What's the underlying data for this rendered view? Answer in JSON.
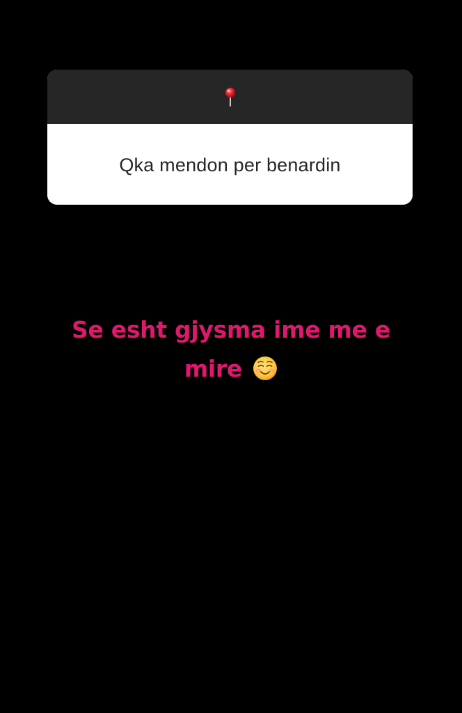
{
  "question_sticker": {
    "icon": "pushpin-icon",
    "question": "Qka mendon per benardin"
  },
  "answer": {
    "line1": "Se esht gjysma ime me e",
    "line2": "mire",
    "emoji": "smiling-face-icon"
  },
  "colors": {
    "background": "#000000",
    "card_header": "#262626",
    "card_body": "#ffffff",
    "question_text": "#262626",
    "answer_text": "#e0176f"
  }
}
